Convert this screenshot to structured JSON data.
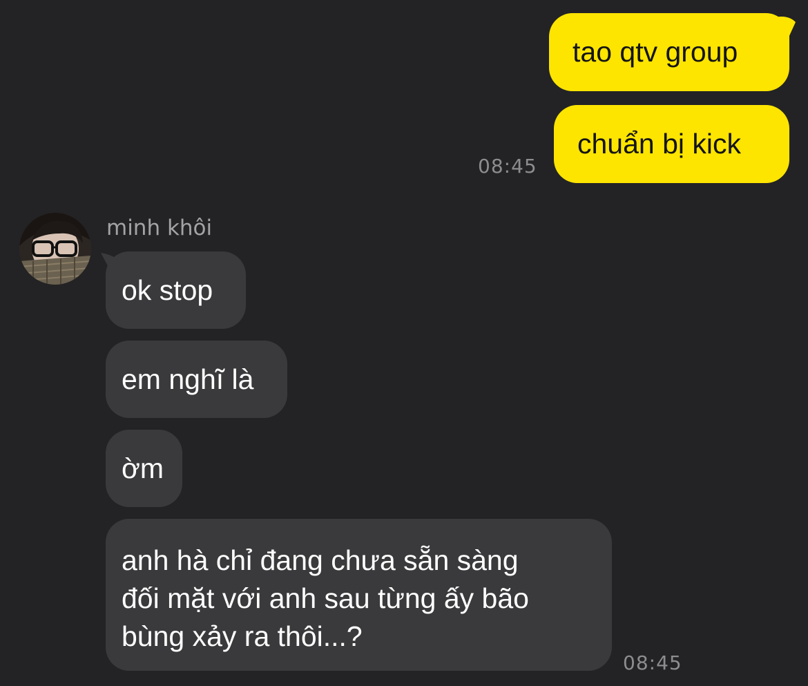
{
  "conversation": {
    "outgoing": [
      {
        "text": "tao qtv group"
      },
      {
        "text": "chuẩn bị kick"
      }
    ],
    "outgoing_time": "08:45",
    "incoming_sender": "minh khôi",
    "incoming": [
      {
        "text": "ok stop"
      },
      {
        "text": "em nghĩ là"
      },
      {
        "text": "ờm"
      },
      {
        "text": "anh hà chỉ đang chưa sẵn sàng\nđối mặt với anh sau từng ấy bão\nbùng xảy ra thôi...?"
      }
    ],
    "incoming_time": "08:45"
  },
  "colors": {
    "background": "#232325",
    "outgoing_bubble": "#fee500",
    "incoming_bubble": "#3a3a3c",
    "timestamp": "#8d8d90"
  },
  "icons": {
    "avatar": "user-avatar-photo"
  }
}
